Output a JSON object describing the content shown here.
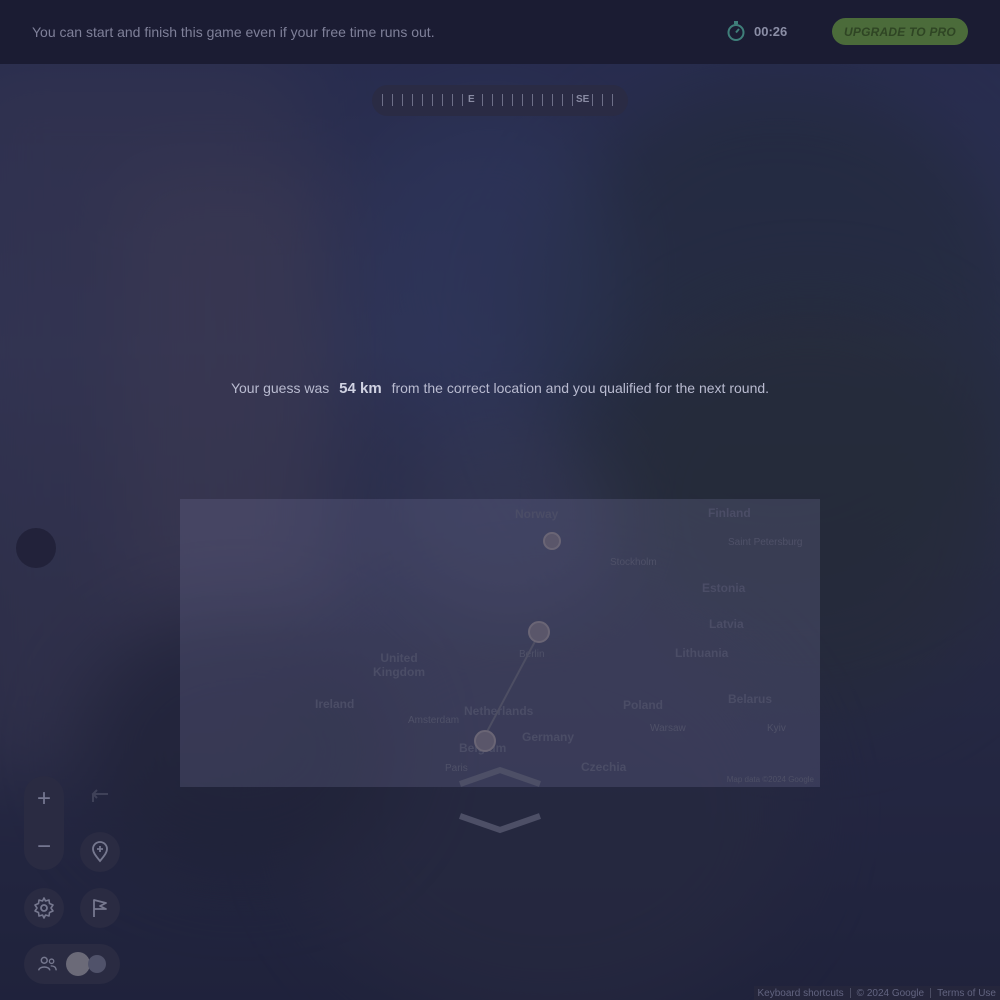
{
  "topbar": {
    "message": "You can start and finish this game even if your free time runs out.",
    "timer": "00:26",
    "upgrade_label": "UPGRADE TO PRO"
  },
  "compass": {
    "labels": [
      "E",
      "SE"
    ]
  },
  "result": {
    "prefix": "Your guess was",
    "distance": "54 km",
    "suffix": "from the correct location and you qualified for the next round."
  },
  "map": {
    "countries": [
      {
        "id": "norway",
        "name": "Norway"
      },
      {
        "id": "finland",
        "name": "Finland"
      },
      {
        "id": "estonia",
        "name": "Estonia"
      },
      {
        "id": "latvia",
        "name": "Latvia"
      },
      {
        "id": "lithuania",
        "name": "Lithuania"
      },
      {
        "id": "united-kingdom",
        "name": "United\nKingdom"
      },
      {
        "id": "ireland",
        "name": "Ireland"
      },
      {
        "id": "netherlands",
        "name": "Netherlands"
      },
      {
        "id": "germany",
        "name": "Germany"
      },
      {
        "id": "poland",
        "name": "Poland"
      },
      {
        "id": "belarus",
        "name": "Belarus"
      },
      {
        "id": "czechia",
        "name": "Czechia"
      },
      {
        "id": "belgium",
        "name": "Belgium"
      }
    ],
    "cities": [
      "Stockholm",
      "Saint Petersburg",
      "Berlin",
      "Warsaw",
      "Kyiv",
      "Paris",
      "Amsterdam"
    ],
    "attribution": "Map data ©2024 Google"
  },
  "footer": {
    "keyboard": "Keyboard shortcuts",
    "copyright": "© 2024 Google",
    "terms": "Terms of Use"
  },
  "controls": {
    "zoom_in": "+",
    "zoom_out": "−"
  }
}
